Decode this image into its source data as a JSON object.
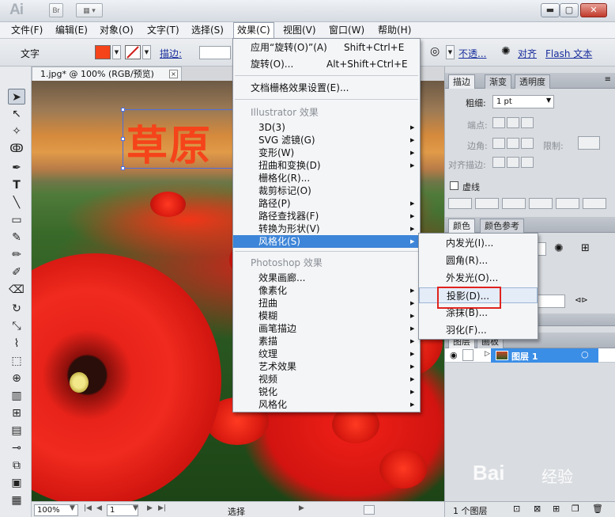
{
  "app": {
    "logo": "Ai",
    "bridge_label": "Br"
  },
  "menubar": {
    "items": [
      "文件(F)",
      "编辑(E)",
      "对象(O)",
      "文字(T)",
      "选择(S)",
      "效果(C)",
      "视图(V)",
      "窗口(W)",
      "帮助(H)"
    ],
    "active": "效果(C)"
  },
  "controlbar": {
    "type_label": "文字",
    "fill_color": "#f5431a",
    "stroke_label": "描边:",
    "opacity_link": "不透...",
    "align_link": "对齐",
    "flash_link": "Flash 文本"
  },
  "document": {
    "tab_title": "1.jpg* @ 100% (RGB/预览)",
    "artwork_text": "草原"
  },
  "statusbar": {
    "zoom": "100%",
    "page": "1",
    "status": "选择"
  },
  "effect_menu": {
    "apply_label": "应用“旋转(O)”(A)",
    "apply_shortcut": "Shift+Ctrl+E",
    "last_label": "旋转(O)...",
    "last_shortcut": "Alt+Shift+Ctrl+E",
    "raster_settings": "文档栅格效果设置(E)...",
    "illustrator_section": "Illustrator 效果",
    "illustrator_items": [
      "3D(3)",
      "SVG 滤镜(G)",
      "变形(W)",
      "扭曲和变换(D)",
      "栅格化(R)...",
      "裁剪标记(O)",
      "路径(P)",
      "路径查找器(F)",
      "转换为形状(V)",
      "风格化(S)"
    ],
    "photoshop_section": "Photoshop 效果",
    "photoshop_items": [
      "效果画廊...",
      "像素化",
      "扭曲",
      "模糊",
      "画笔描边",
      "素描",
      "纹理",
      "艺术效果",
      "视频",
      "锐化",
      "风格化"
    ]
  },
  "stylize_menu": {
    "items": [
      "内发光(I)...",
      "圆角(R)...",
      "外发光(O)...",
      "投影(D)...",
      "涂抹(B)...",
      "羽化(F)..."
    ],
    "highlighted": "投影(D)..."
  },
  "stroke_panel": {
    "tabs": [
      "描边",
      "渐变",
      "透明度"
    ],
    "weight_label": "粗细:",
    "weight_value": "1 pt",
    "cap_label": "端点:",
    "corner_label": "边角:",
    "limit_label": "限制:",
    "align_label": "对齐描边:",
    "dashed_label": "虚线"
  },
  "color_panel": {
    "tabs": [
      "颜色",
      "颜色参考"
    ]
  },
  "layers_panel": {
    "tabs": [
      "图层",
      "画板"
    ],
    "layer_name": "图层 1",
    "footer_count": "1 个图层"
  },
  "watermark": {
    "text": "Bai",
    "sub": "经验"
  }
}
